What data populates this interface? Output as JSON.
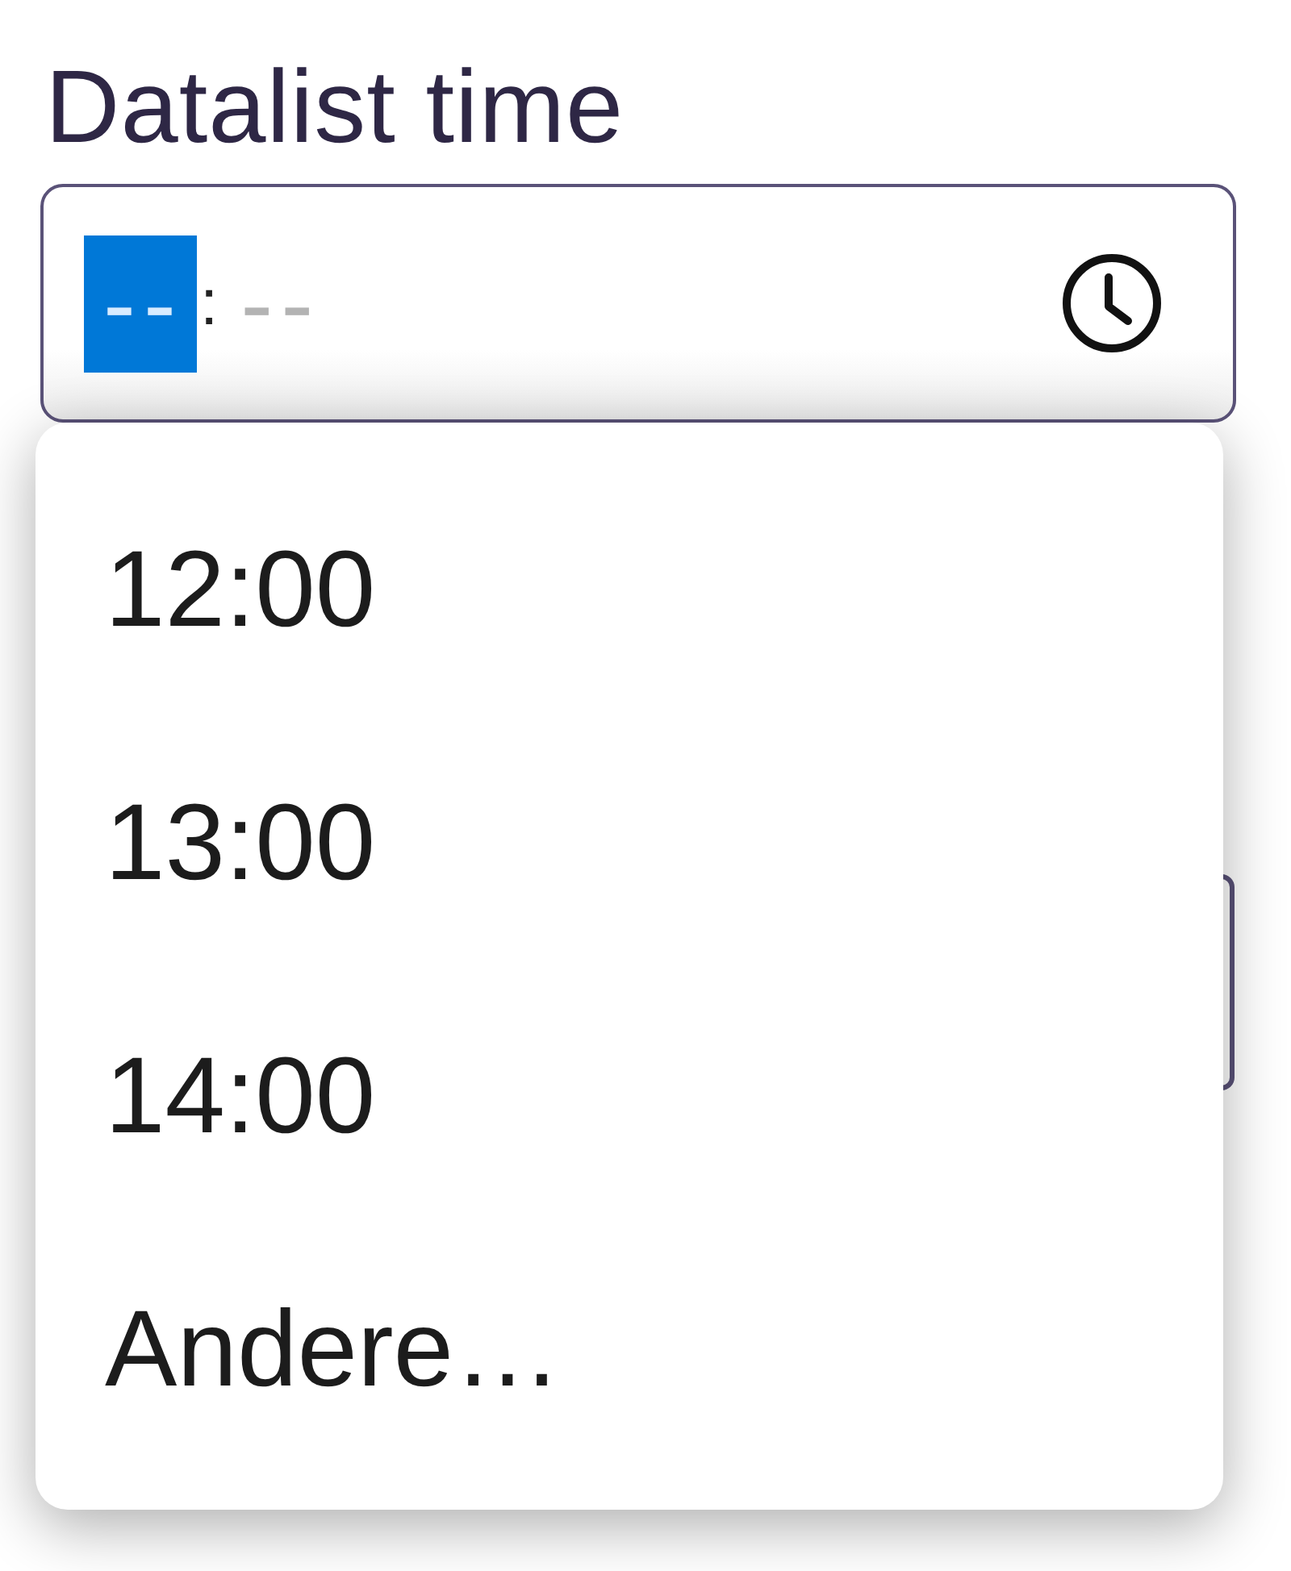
{
  "time_field": {
    "label": "Datalist time",
    "segments": [
      {
        "text": "--",
        "selected": true
      },
      {
        "text": "--",
        "selected": false
      }
    ],
    "separator": ":"
  },
  "datalist": {
    "options": [
      {
        "label": "12:00",
        "selected": false
      },
      {
        "label": "13:00",
        "selected": false
      },
      {
        "label": "14:00",
        "selected": false
      },
      {
        "label": "Andere…",
        "selected": false
      }
    ]
  }
}
